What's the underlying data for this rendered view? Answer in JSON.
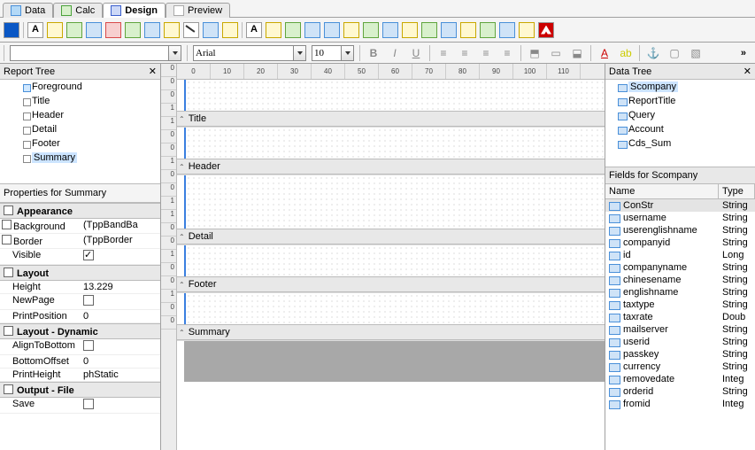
{
  "tabs": {
    "data": "Data",
    "calc": "Calc",
    "design": "Design",
    "preview": "Preview",
    "active": "design"
  },
  "toolbar2": {
    "font": "Arial",
    "size": "10"
  },
  "reportTree": {
    "title": "Report Tree",
    "nodes": [
      {
        "label": "Foreground",
        "cls": "fg"
      },
      {
        "label": "Title"
      },
      {
        "label": "Header"
      },
      {
        "label": "Detail"
      },
      {
        "label": "Footer"
      },
      {
        "label": "Summary",
        "selected": true
      }
    ]
  },
  "props": {
    "title": "Properties for Summary",
    "categories": [
      {
        "name": "Appearance",
        "rows": [
          {
            "name": "Background",
            "value": "(TppBandBa",
            "exp": true
          },
          {
            "name": "Border",
            "value": "(TppBorder",
            "exp": true
          },
          {
            "name": "Visible",
            "value": true,
            "type": "check"
          }
        ]
      },
      {
        "name": "Layout",
        "rows": [
          {
            "name": "Height",
            "value": "13.229"
          },
          {
            "name": "NewPage",
            "value": false,
            "type": "check"
          },
          {
            "name": "PrintPosition",
            "value": "0"
          }
        ]
      },
      {
        "name": "Layout - Dynamic",
        "rows": [
          {
            "name": "AlignToBottom",
            "value": false,
            "type": "check"
          },
          {
            "name": "BottomOffset",
            "value": "0"
          },
          {
            "name": "PrintHeight",
            "value": "phStatic"
          }
        ]
      },
      {
        "name": "Output - File",
        "rows": [
          {
            "name": "Save",
            "value": false,
            "type": "check"
          }
        ]
      }
    ]
  },
  "bands": [
    {
      "label": "Title",
      "short": true
    },
    {
      "label": "Header",
      "short": true
    },
    {
      "label": "Detail"
    },
    {
      "label": "Footer",
      "short": true
    },
    {
      "label": "Summary",
      "short": true
    }
  ],
  "hruler": [
    "0",
    "10",
    "20",
    "30",
    "40",
    "50",
    "60",
    "70",
    "80",
    "90",
    "100",
    "110"
  ],
  "vruler": [
    "0",
    "0",
    "0",
    "1",
    "1",
    "0",
    "0",
    "1",
    "0",
    "0",
    "1",
    "1",
    "0",
    "0",
    "1",
    "0",
    "0",
    "1",
    "0",
    "0"
  ],
  "dataTree": {
    "title": "Data Tree",
    "nodes": [
      {
        "label": "Scompany",
        "selected": true
      },
      {
        "label": "ReportTitle"
      },
      {
        "label": "Query"
      },
      {
        "label": "Account"
      },
      {
        "label": "Cds_Sum"
      }
    ],
    "fieldsHeading": "Fields for Scompany",
    "cols": {
      "name": "Name",
      "type": "Type"
    },
    "fields": [
      {
        "name": "ConStr",
        "type": "String",
        "selected": true
      },
      {
        "name": "username",
        "type": "String"
      },
      {
        "name": "userenglishname",
        "type": "String"
      },
      {
        "name": "companyid",
        "type": "String"
      },
      {
        "name": "id",
        "type": "Long"
      },
      {
        "name": "companyname",
        "type": "String"
      },
      {
        "name": "chinesename",
        "type": "String"
      },
      {
        "name": "englishname",
        "type": "String"
      },
      {
        "name": "taxtype",
        "type": "String"
      },
      {
        "name": "taxrate",
        "type": "Doub"
      },
      {
        "name": "mailserver",
        "type": "String"
      },
      {
        "name": "userid",
        "type": "String"
      },
      {
        "name": "passkey",
        "type": "String"
      },
      {
        "name": "currency",
        "type": "String"
      },
      {
        "name": "removedate",
        "type": "Integ"
      },
      {
        "name": "orderid",
        "type": "String"
      },
      {
        "name": "fromid",
        "type": "Integ"
      }
    ]
  }
}
